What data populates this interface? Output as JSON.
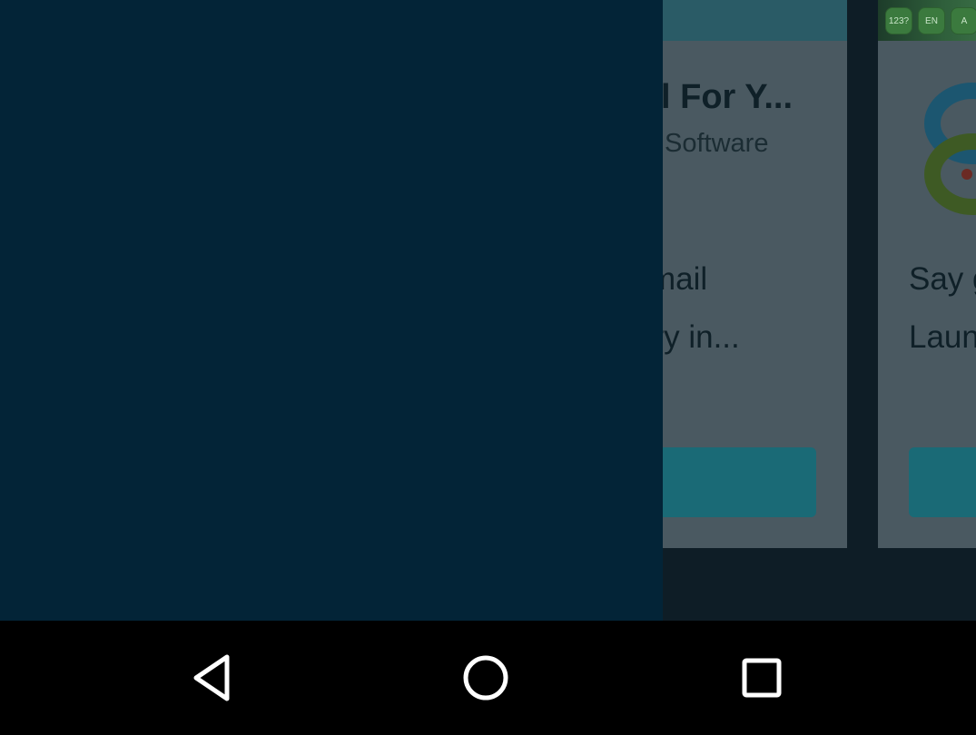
{
  "cards": [
    {
      "title": "l For Y...",
      "subtitle": "Software",
      "desc_line1": "mail",
      "desc_line2": "ary in...",
      "button_label": ""
    },
    {
      "title": "",
      "subtitle": "",
      "desc_line1": "Say g",
      "desc_line2": "Laun",
      "button_label": ""
    }
  ],
  "keyboard_keys": [
    "123?",
    "EN",
    "A"
  ],
  "navigation": {
    "back": "back-icon",
    "home": "home-icon",
    "recents": "recents-icon"
  },
  "colors": {
    "side_panel": "#032437",
    "navbar": "#000000",
    "card_button": "#1a6a76"
  }
}
